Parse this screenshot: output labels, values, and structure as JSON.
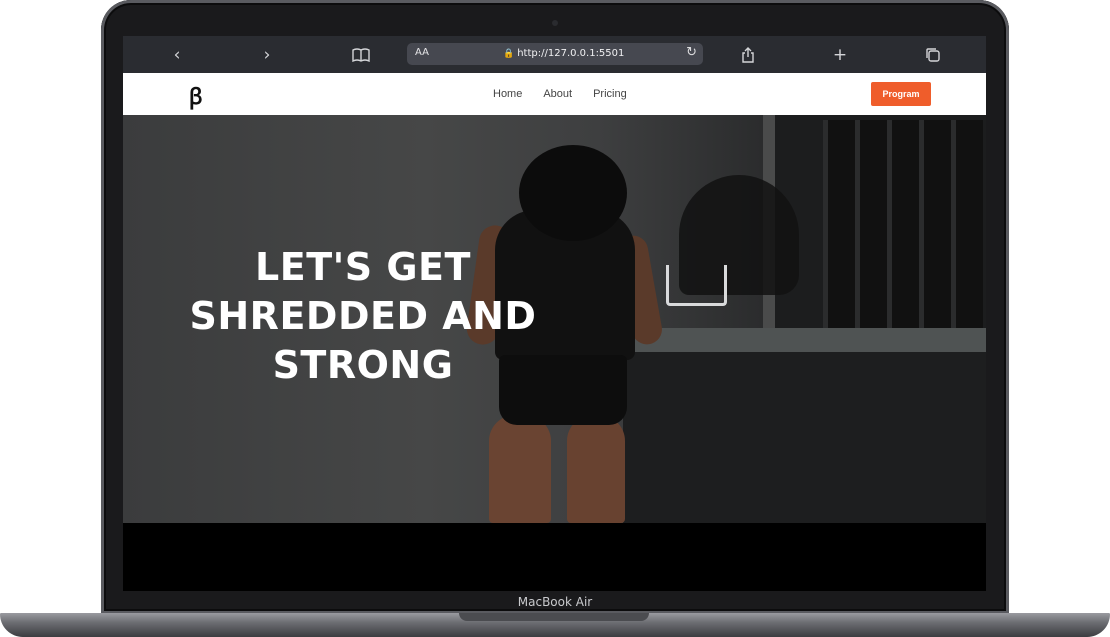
{
  "device": {
    "label": "MacBook Air"
  },
  "browser": {
    "back_icon": "chevron-left",
    "forward_icon": "chevron-right",
    "reader_icon": "book-icon",
    "text_size_label": "AA",
    "url": "http://127.0.0.1:5501",
    "share_icon": "share-icon",
    "new_tab_icon": "plus-icon",
    "tabs_icon": "tabs-icon"
  },
  "site": {
    "logo": "ꞵ",
    "nav": [
      "Home",
      "About",
      "Pricing"
    ],
    "cta_label": "Program",
    "cta_color": "#ef5d2b",
    "hero_title": "LET'S GET SHREDDED AND STRONG"
  }
}
